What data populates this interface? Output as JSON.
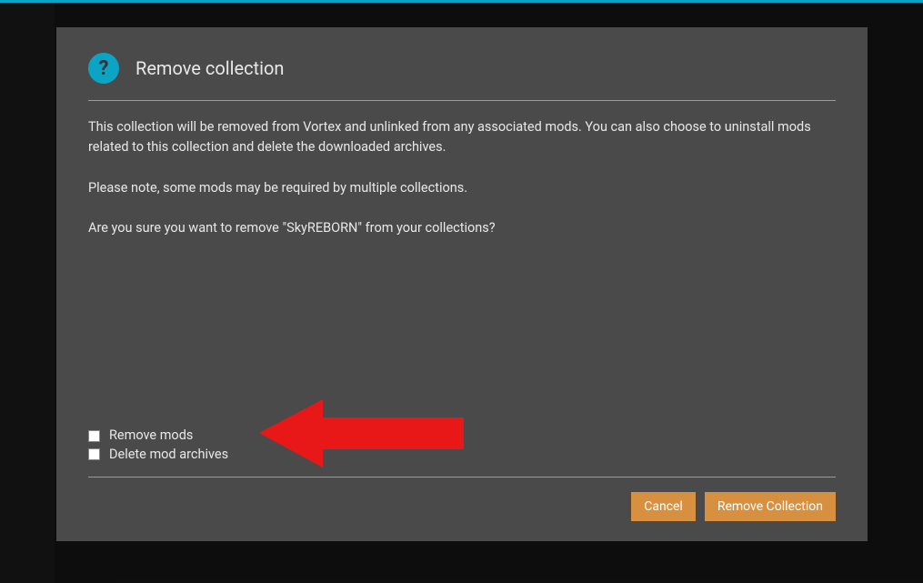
{
  "dialog": {
    "title": "Remove collection",
    "body": {
      "p1": "This collection will be removed from Vortex and unlinked from any associated mods. You can also choose to uninstall mods related to this collection and delete the downloaded archives.",
      "p2": "Please note, some mods may be required by multiple collections.",
      "p3": "Are you sure you want to remove \"SkyREBORN\" from your collections?"
    },
    "checkboxes": {
      "remove_mods": "Remove mods",
      "delete_archives": "Delete mod archives"
    },
    "buttons": {
      "cancel": "Cancel",
      "remove": "Remove Collection"
    }
  },
  "annotation": {
    "arrow_color": "#e91818"
  }
}
